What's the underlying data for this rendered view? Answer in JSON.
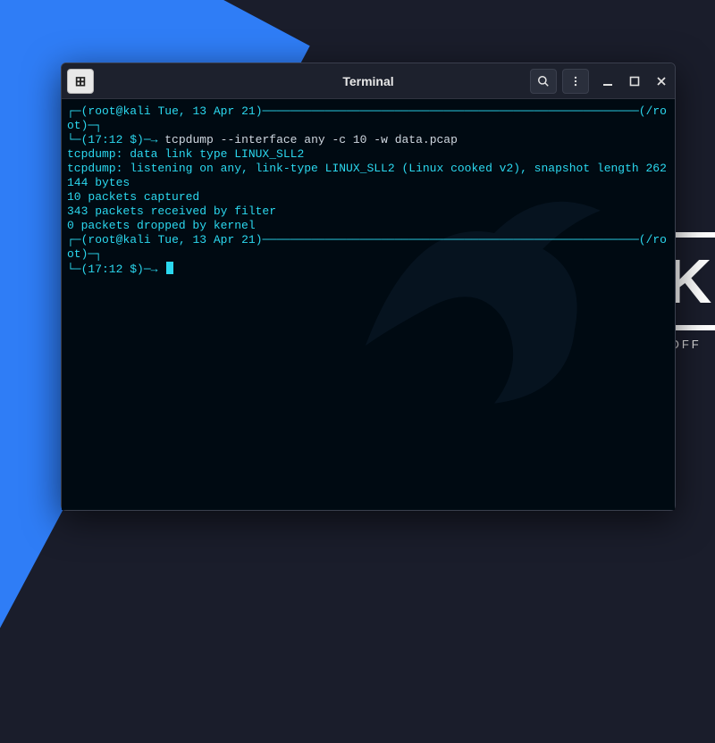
{
  "desktop": {
    "logo_letter": "K",
    "logo_sub": "BY OFF"
  },
  "window": {
    "title": "Terminal",
    "newtab_tooltip": "New Tab",
    "search_tooltip": "Search",
    "menu_tooltip": "Menu",
    "minimize_tooltip": "Minimize",
    "maximize_tooltip": "Maximize",
    "close_tooltip": "Close"
  },
  "terminal": {
    "prompt1_user": "root",
    "prompt1_at": "@",
    "prompt1_host": "kali",
    "prompt1_date": "Tue, 13 Apr 21",
    "prompt1_pwd": "/root",
    "prompt1_time": "17:12 $",
    "prompt1_arrow": "→",
    "command1": "tcpdump --interface any -c 10 -w data.pcap",
    "output_lines": [
      "tcpdump: data link type LINUX_SLL2",
      "tcpdump: listening on any, link-type LINUX_SLL2 (Linux cooked v2), snapshot length 262144 bytes",
      "10 packets captured",
      "343 packets received by filter",
      "0 packets dropped by kernel"
    ],
    "prompt2_user": "root",
    "prompt2_at": "@",
    "prompt2_host": "kali",
    "prompt2_date": "Tue, 13 Apr 21",
    "prompt2_pwd": "/root",
    "prompt2_time": "17:12 $",
    "prompt2_arrow": "→",
    "command2": ""
  }
}
